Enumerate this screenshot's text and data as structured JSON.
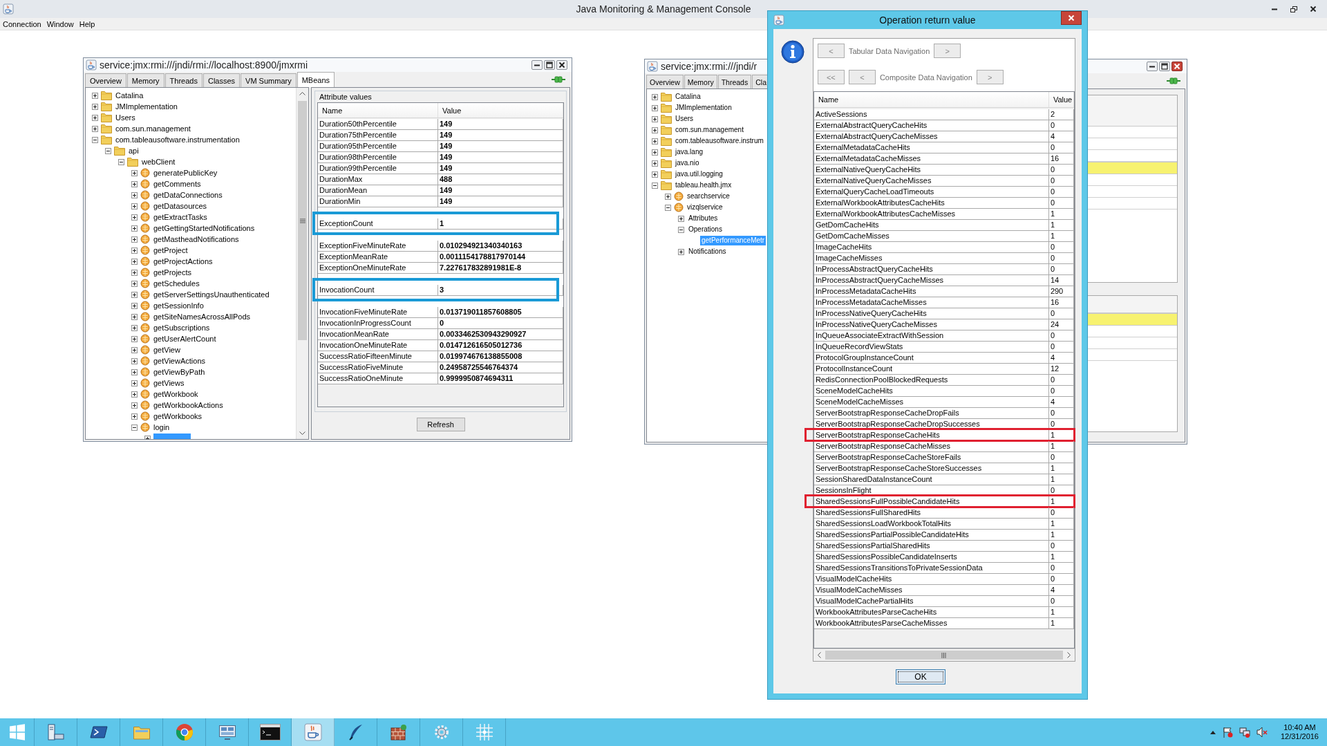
{
  "app": {
    "title": "Java Monitoring & Management Console",
    "menu": [
      "Connection",
      "Window",
      "Help"
    ]
  },
  "left_window": {
    "title": "service:jmx:rmi:///jndi/rmi://localhost:8900/jmxrmi",
    "tabs": [
      {
        "label": "Overview",
        "selected": false
      },
      {
        "label": "Memory",
        "selected": false
      },
      {
        "label": "Threads",
        "selected": false
      },
      {
        "label": "Classes",
        "selected": false
      },
      {
        "label": "VM Summary",
        "selected": false
      },
      {
        "label": "MBeans",
        "selected": true
      }
    ],
    "tree": [
      {
        "label": "Catalina",
        "kind": "folder",
        "expanded": false,
        "selected": false
      },
      {
        "label": "JMImplementation",
        "kind": "folder",
        "expanded": false,
        "selected": false
      },
      {
        "label": "Users",
        "kind": "folder",
        "expanded": false,
        "selected": false
      },
      {
        "label": "com.sun.management",
        "kind": "folder",
        "expanded": false,
        "selected": false
      },
      {
        "label": "com.tableausoftware.instrumentation",
        "kind": "folder",
        "expanded": true,
        "selected": false,
        "children": [
          {
            "label": "api",
            "kind": "folder",
            "expanded": true,
            "selected": false,
            "children": [
              {
                "label": "webClient",
                "kind": "folder",
                "expanded": true,
                "selected": false,
                "children": [
                  {
                    "label": "generatePublicKey",
                    "kind": "bean",
                    "expanded": false,
                    "selected": false
                  },
                  {
                    "label": "getComments",
                    "kind": "bean",
                    "expanded": false,
                    "selected": false
                  },
                  {
                    "label": "getDataConnections",
                    "kind": "bean",
                    "expanded": false,
                    "selected": false
                  },
                  {
                    "label": "getDatasources",
                    "kind": "bean",
                    "expanded": false,
                    "selected": false
                  },
                  {
                    "label": "getExtractTasks",
                    "kind": "bean",
                    "expanded": false,
                    "selected": false
                  },
                  {
                    "label": "getGettingStartedNotifications",
                    "kind": "bean",
                    "expanded": false,
                    "selected": false
                  },
                  {
                    "label": "getMastheadNotifications",
                    "kind": "bean",
                    "expanded": false,
                    "selected": false
                  },
                  {
                    "label": "getProject",
                    "kind": "bean",
                    "expanded": false,
                    "selected": false
                  },
                  {
                    "label": "getProjectActions",
                    "kind": "bean",
                    "expanded": false,
                    "selected": false
                  },
                  {
                    "label": "getProjects",
                    "kind": "bean",
                    "expanded": false,
                    "selected": false
                  },
                  {
                    "label": "getSchedules",
                    "kind": "bean",
                    "expanded": false,
                    "selected": false
                  },
                  {
                    "label": "getServerSettingsUnauthenticated",
                    "kind": "bean",
                    "expanded": false,
                    "selected": false
                  },
                  {
                    "label": "getSessionInfo",
                    "kind": "bean",
                    "expanded": false,
                    "selected": false
                  },
                  {
                    "label": "getSiteNamesAcrossAllPods",
                    "kind": "bean",
                    "expanded": false,
                    "selected": false
                  },
                  {
                    "label": "getSubscriptions",
                    "kind": "bean",
                    "expanded": false,
                    "selected": false
                  },
                  {
                    "label": "getUserAlertCount",
                    "kind": "bean",
                    "expanded": false,
                    "selected": false
                  },
                  {
                    "label": "getView",
                    "kind": "bean",
                    "expanded": false,
                    "selected": false
                  },
                  {
                    "label": "getViewActions",
                    "kind": "bean",
                    "expanded": false,
                    "selected": false
                  },
                  {
                    "label": "getViewByPath",
                    "kind": "bean",
                    "expanded": false,
                    "selected": false
                  },
                  {
                    "label": "getViews",
                    "kind": "bean",
                    "expanded": false,
                    "selected": false
                  },
                  {
                    "label": "getWorkbook",
                    "kind": "bean",
                    "expanded": false,
                    "selected": false
                  },
                  {
                    "label": "getWorkbookActions",
                    "kind": "bean",
                    "expanded": false,
                    "selected": false
                  },
                  {
                    "label": "getWorkbooks",
                    "kind": "bean",
                    "expanded": false,
                    "selected": false
                  },
                  {
                    "label": "login",
                    "kind": "bean",
                    "expanded": true,
                    "selected": false,
                    "children": [
                      {
                        "expanded": false,
                        "selected": true
                      }
                    ]
                  }
                ]
              }
            ]
          }
        ]
      }
    ],
    "attributes": {
      "title": "Attribute values",
      "columns": [
        "Name",
        "Value"
      ],
      "rows": [
        {
          "name": "Duration50thPercentile",
          "value": "149",
          "highlighted": false
        },
        {
          "name": "Duration75thPercentile",
          "value": "149",
          "highlighted": false
        },
        {
          "name": "Duration95thPercentile",
          "value": "149",
          "highlighted": false
        },
        {
          "name": "Duration98thPercentile",
          "value": "149",
          "highlighted": false
        },
        {
          "name": "Duration99thPercentile",
          "value": "149",
          "highlighted": false
        },
        {
          "name": "DurationMax",
          "value": "488",
          "highlighted": false
        },
        {
          "name": "DurationMean",
          "value": "149",
          "highlighted": false
        },
        {
          "name": "DurationMin",
          "value": "149",
          "highlighted": false
        },
        {
          "name": "ExceptionCount",
          "value": "1",
          "highlighted": true
        },
        {
          "name": "ExceptionFiveMinuteRate",
          "value": "0.010294921340340163",
          "highlighted": false
        },
        {
          "name": "ExceptionMeanRate",
          "value": "0.0011154178817970144",
          "highlighted": false
        },
        {
          "name": "ExceptionOneMinuteRate",
          "value": "7.227617832891981E-8",
          "highlighted": false
        },
        {
          "name": "InvocationCount",
          "value": "3",
          "highlighted": true
        },
        {
          "name": "InvocationFiveMinuteRate",
          "value": "0.013719011857608805",
          "highlighted": false
        },
        {
          "name": "InvocationInProgressCount",
          "value": "0",
          "highlighted": false
        },
        {
          "name": "InvocationMeanRate",
          "value": "0.0033462530943290927",
          "highlighted": false
        },
        {
          "name": "InvocationOneMinuteRate",
          "value": "0.014712616505012736",
          "highlighted": false
        },
        {
          "name": "SuccessRatioFifteenMinute",
          "value": "0.019974676138855008",
          "highlighted": false
        },
        {
          "name": "SuccessRatioFiveMinute",
          "value": "0.24958725546764374",
          "highlighted": false
        },
        {
          "name": "SuccessRatioOneMinute",
          "value": "0.9999950874694311",
          "highlighted": false
        }
      ]
    },
    "refresh_button": "Refresh"
  },
  "back_window": {
    "title": "service:jmx:rmi:///jndi/r",
    "tabs": [
      {
        "label": "Overview",
        "selected": false
      },
      {
        "label": "Memory",
        "selected": false
      },
      {
        "label": "Threads",
        "selected": false
      },
      {
        "label": "Cla",
        "selected": false
      }
    ],
    "tree": [
      {
        "label": "Catalina",
        "kind": "folder",
        "expanded": false,
        "selected": false
      },
      {
        "label": "JMImplementation",
        "kind": "folder",
        "expanded": false,
        "selected": false
      },
      {
        "label": "Users",
        "kind": "folder",
        "expanded": false,
        "selected": false
      },
      {
        "label": "com.sun.management",
        "kind": "folder",
        "expanded": false,
        "selected": false
      },
      {
        "label": "com.tableausoftware.instrum",
        "kind": "folder",
        "expanded": false,
        "selected": false
      },
      {
        "label": "java.lang",
        "kind": "folder",
        "expanded": false,
        "selected": false
      },
      {
        "label": "java.nio",
        "kind": "folder",
        "expanded": false,
        "selected": false
      },
      {
        "label": "java.util.logging",
        "kind": "folder",
        "expanded": false,
        "selected": false
      },
      {
        "label": "tableau.health.jmx",
        "kind": "folder",
        "expanded": true,
        "selected": false,
        "children": [
          {
            "label": "searchservice",
            "kind": "bean",
            "expanded": false,
            "selected": false
          },
          {
            "label": "vizqlservice",
            "kind": "bean",
            "expanded": true,
            "selected": false,
            "children": [
              {
                "label": "Attributes",
                "expanded": false,
                "selected": false
              },
              {
                "label": "Operations",
                "expanded": true,
                "selected": false,
                "children": [
                  {
                    "label": "getPerformanceMetr",
                    "selected": true
                  }
                ]
              },
              {
                "label": "Notifications",
                "expanded": false,
                "selected": false
              }
            ]
          }
        ]
      }
    ]
  },
  "dialog": {
    "title": "Operation return value",
    "tabular_nav": [
      {
        "kind": "button",
        "label": "<",
        "disabled": true
      },
      {
        "kind": "label",
        "label": "Tabular Data Navigation"
      },
      {
        "kind": "button",
        "label": ">",
        "disabled": true
      }
    ],
    "composite_nav": [
      {
        "kind": "button",
        "label": "<<",
        "disabled": true
      },
      {
        "kind": "button",
        "label": "<",
        "disabled": true
      },
      {
        "kind": "label",
        "label": "Composite Data Navigation"
      },
      {
        "kind": "button",
        "label": ">",
        "disabled": true
      }
    ],
    "columns": [
      "Name",
      "Value"
    ],
    "rows": [
      {
        "name": "ActiveSessions",
        "value": "2",
        "highlighted": false
      },
      {
        "name": "ExternalAbstractQueryCacheHits",
        "value": "0",
        "highlighted": false
      },
      {
        "name": "ExternalAbstractQueryCacheMisses",
        "value": "4",
        "highlighted": false
      },
      {
        "name": "ExternalMetadataCacheHits",
        "value": "0",
        "highlighted": false
      },
      {
        "name": "ExternalMetadataCacheMisses",
        "value": "16",
        "highlighted": false
      },
      {
        "name": "ExternalNativeQueryCacheHits",
        "value": "0",
        "highlighted": false
      },
      {
        "name": "ExternalNativeQueryCacheMisses",
        "value": "0",
        "highlighted": false
      },
      {
        "name": "ExternalQueryCacheLoadTimeouts",
        "value": "0",
        "highlighted": false
      },
      {
        "name": "ExternalWorkbookAttributesCacheHits",
        "value": "0",
        "highlighted": false
      },
      {
        "name": "ExternalWorkbookAttributesCacheMisses",
        "value": "1",
        "highlighted": false
      },
      {
        "name": "GetDomCacheHits",
        "value": "1",
        "highlighted": false
      },
      {
        "name": "GetDomCacheMisses",
        "value": "1",
        "highlighted": false
      },
      {
        "name": "ImageCacheHits",
        "value": "0",
        "highlighted": false
      },
      {
        "name": "ImageCacheMisses",
        "value": "0",
        "highlighted": false
      },
      {
        "name": "InProcessAbstractQueryCacheHits",
        "value": "0",
        "highlighted": false
      },
      {
        "name": "InProcessAbstractQueryCacheMisses",
        "value": "14",
        "highlighted": false
      },
      {
        "name": "InProcessMetadataCacheHits",
        "value": "290",
        "highlighted": false
      },
      {
        "name": "InProcessMetadataCacheMisses",
        "value": "16",
        "highlighted": false
      },
      {
        "name": "InProcessNativeQueryCacheHits",
        "value": "0",
        "highlighted": false
      },
      {
        "name": "InProcessNativeQueryCacheMisses",
        "value": "24",
        "highlighted": false
      },
      {
        "name": "InQueueAssociateExtractWithSession",
        "value": "0",
        "highlighted": false
      },
      {
        "name": "InQueueRecordViewStats",
        "value": "0",
        "highlighted": false
      },
      {
        "name": "ProtocolGroupInstanceCount",
        "value": "4",
        "highlighted": false
      },
      {
        "name": "ProtocolInstanceCount",
        "value": "12",
        "highlighted": false
      },
      {
        "name": "RedisConnectionPoolBlockedRequests",
        "value": "0",
        "highlighted": false
      },
      {
        "name": "SceneModelCacheHits",
        "value": "0",
        "highlighted": false
      },
      {
        "name": "SceneModelCacheMisses",
        "value": "4",
        "highlighted": false
      },
      {
        "name": "ServerBootstrapResponseCacheDropFails",
        "value": "0",
        "highlighted": false
      },
      {
        "name": "ServerBootstrapResponseCacheDropSuccesses",
        "value": "0",
        "highlighted": false
      },
      {
        "name": "ServerBootstrapResponseCacheHits",
        "value": "1",
        "highlighted": true
      },
      {
        "name": "ServerBootstrapResponseCacheMisses",
        "value": "1",
        "highlighted": false
      },
      {
        "name": "ServerBootstrapResponseCacheStoreFails",
        "value": "0",
        "highlighted": false
      },
      {
        "name": "ServerBootstrapResponseCacheStoreSuccesses",
        "value": "1",
        "highlighted": false
      },
      {
        "name": "SessionSharedDataInstanceCount",
        "value": "1",
        "highlighted": false
      },
      {
        "name": "SessionsInFlight",
        "value": "0",
        "highlighted": false
      },
      {
        "name": "SharedSessionsFullPossibleCandidateHits",
        "value": "1",
        "highlighted": true
      },
      {
        "name": "SharedSessionsFullSharedHits",
        "value": "0",
        "highlighted": false
      },
      {
        "name": "SharedSessionsLoadWorkbookTotalHits",
        "value": "1",
        "highlighted": false
      },
      {
        "name": "SharedSessionsPartialPossibleCandidateHits",
        "value": "1",
        "highlighted": false
      },
      {
        "name": "SharedSessionsPartialSharedHits",
        "value": "0",
        "highlighted": false
      },
      {
        "name": "SharedSessionsPossibleCandidateInserts",
        "value": "1",
        "highlighted": false
      },
      {
        "name": "SharedSessionsTransitionsToPrivateSessionData",
        "value": "0",
        "highlighted": false
      },
      {
        "name": "VisualModelCacheHits",
        "value": "0",
        "highlighted": false
      },
      {
        "name": "VisualModelCacheMisses",
        "value": "4",
        "highlighted": false
      },
      {
        "name": "VisualModelCachePartialHits",
        "value": "0",
        "highlighted": false
      },
      {
        "name": "WorkbookAttributesParseCacheHits",
        "value": "1",
        "highlighted": false
      },
      {
        "name": "WorkbookAttributesParseCacheMisses",
        "value": "1",
        "highlighted": false
      }
    ],
    "ok_button": "OK"
  },
  "taskbar": {
    "apps": [
      {
        "kind": "start",
        "selected": false
      },
      {
        "kind": "server",
        "selected": false
      },
      {
        "kind": "shell",
        "selected": false
      },
      {
        "kind": "explorer",
        "selected": false
      },
      {
        "kind": "browser",
        "selected": false
      },
      {
        "kind": "dashboard",
        "selected": false
      },
      {
        "kind": "console",
        "selected": false
      },
      {
        "kind": "java",
        "selected": true
      },
      {
        "kind": "quill",
        "selected": false
      },
      {
        "kind": "wall",
        "selected": false
      },
      {
        "kind": "gear",
        "selected": false
      },
      {
        "kind": "grid",
        "selected": false
      }
    ],
    "time": "10:40 AM",
    "date": "12/31/2016"
  }
}
